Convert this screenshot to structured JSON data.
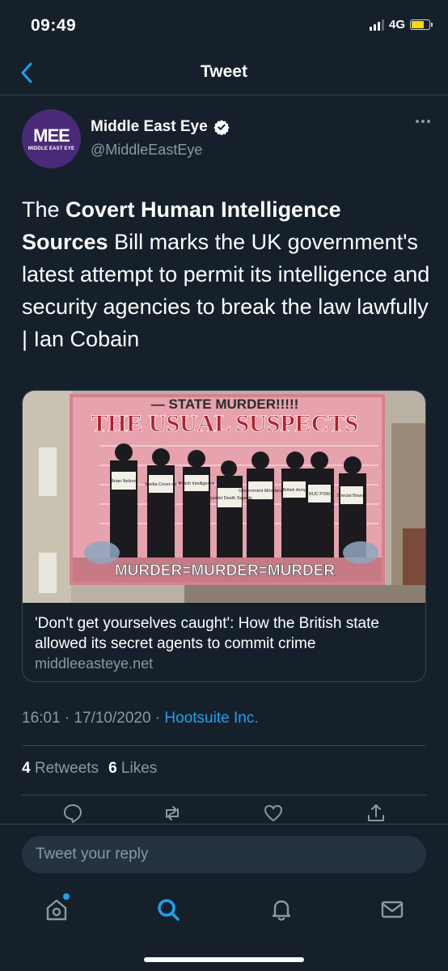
{
  "status_bar": {
    "time": "09:49",
    "network": "4G",
    "signal_bars_filled": 3,
    "signal_bars_total": 4,
    "battery_level": 0.7,
    "battery_color": "#ffd60a"
  },
  "header": {
    "back_icon": "chevron-left-icon",
    "title": "Tweet"
  },
  "tweet": {
    "author": {
      "name": "Middle East Eye",
      "handle": "@MiddleEastEye",
      "avatar_mark": "MEE",
      "avatar_sub": "MIDDLE EAST EYE",
      "verified": true
    },
    "text": {
      "intro": "The ",
      "bold": "Covert Human Intelligence Sources",
      "rest": " Bill marks the UK government's latest attempt to permit its intelligence and security agencies to break the law lawfully | Ian Cobain"
    },
    "card": {
      "image_alt": "Mural titled The Usual Suspects",
      "mural_top": "— STATE MURDER!!!!!",
      "mural_title": "THE USUAL SUSPECTS",
      "mural_bottom": "MURDER=MURDER=MURDER",
      "placards": [
        "Brian Nelson",
        "Media Cover-up",
        "British Intelligence",
        "Loyalist Death Squads",
        "Government Ministers",
        "British Army",
        "RUC PSNI",
        "Special Branch"
      ],
      "title": "'Don't get yourselves caught': How the British state allowed its secret agents to commit crime",
      "domain": "middleeasteye.net"
    },
    "timestamp": "16:01 · 17/10/2020 · ",
    "source": "Hootsuite Inc.",
    "retweets_count": "4",
    "retweets_label": "Retweets",
    "likes_count": "6",
    "likes_label": "Likes"
  },
  "reply": {
    "placeholder": "Tweet your reply"
  },
  "tab_bar": {
    "items": [
      "home-icon",
      "search-icon",
      "notifications-icon",
      "messages-icon"
    ],
    "active": "search-icon",
    "accent": "#1da1f2"
  }
}
